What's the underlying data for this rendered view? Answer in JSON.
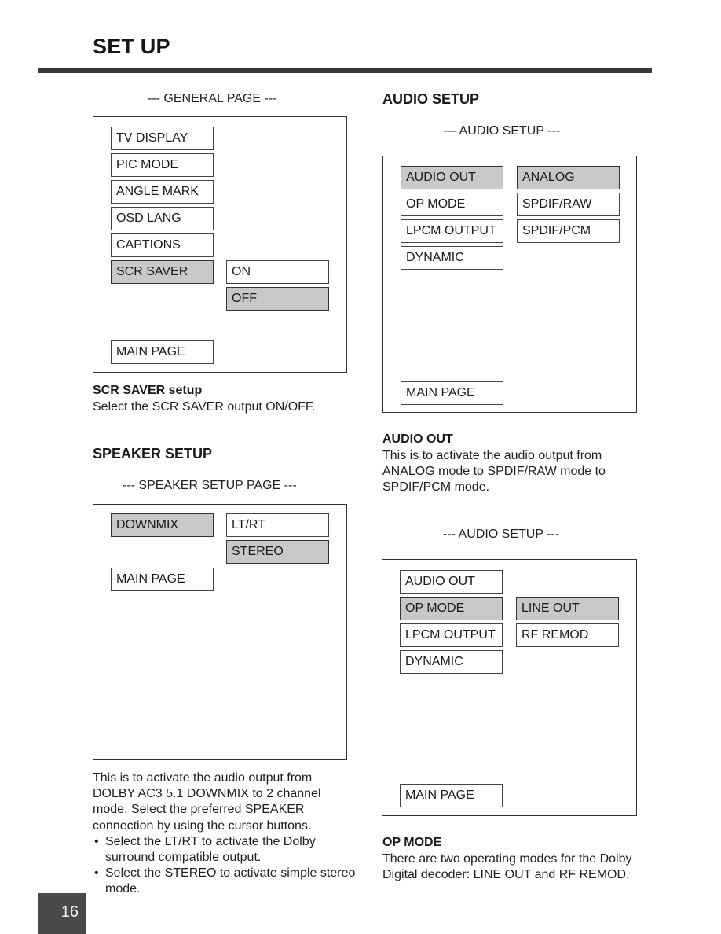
{
  "page": {
    "title": "SET UP",
    "page_number": "16"
  },
  "general": {
    "caption": "--- GENERAL PAGE ---",
    "menu": [
      {
        "label": "TV DISPLAY",
        "selected": false
      },
      {
        "label": "PIC MODE",
        "selected": false
      },
      {
        "label": "ANGLE MARK",
        "selected": false
      },
      {
        "label": "OSD LANG",
        "selected": false
      },
      {
        "label": "CAPTIONS",
        "selected": false
      },
      {
        "label": "SCR SAVER",
        "selected": true
      }
    ],
    "options": [
      {
        "label": "ON",
        "selected": false
      },
      {
        "label": "OFF",
        "selected": true
      }
    ],
    "main_page": "MAIN PAGE",
    "desc_title": "SCR SAVER setup",
    "desc_body": "Select the SCR SAVER output ON/OFF."
  },
  "speaker": {
    "heading": "SPEAKER SETUP",
    "caption": "--- SPEAKER SETUP PAGE ---",
    "menu": [
      {
        "label": "DOWNMIX",
        "selected": true
      }
    ],
    "options": [
      {
        "label": "LT/RT",
        "selected": false
      },
      {
        "label": "STEREO",
        "selected": true
      }
    ],
    "main_page": "MAIN PAGE",
    "desc_body": "This is to activate the audio output from DOLBY AC3 5.1 DOWNMIX to 2 channel mode.  Select the preferred SPEAKER connection by using the cursor buttons.",
    "bullets": [
      "Select the LT/RT to activate the Dolby surround compatible output.",
      "Select the STEREO to activate simple stereo mode."
    ]
  },
  "audio": {
    "heading": "AUDIO SETUP",
    "panel1": {
      "caption": "--- AUDIO SETUP ---",
      "menu": [
        {
          "label": "AUDIO OUT",
          "selected": true
        },
        {
          "label": "OP MODE",
          "selected": false
        },
        {
          "label": "LPCM OUTPUT",
          "selected": false
        },
        {
          "label": "DYNAMIC",
          "selected": false
        }
      ],
      "options": [
        {
          "label": "ANALOG",
          "selected": true
        },
        {
          "label": "SPDIF/RAW",
          "selected": false
        },
        {
          "label": "SPDIF/PCM",
          "selected": false
        }
      ],
      "main_page": "MAIN PAGE",
      "desc_title": "AUDIO OUT",
      "desc_body": "This is to activate the audio output from ANALOG mode to SPDIF/RAW mode to SPDIF/PCM mode."
    },
    "panel2": {
      "caption": "--- AUDIO SETUP ---",
      "menu": [
        {
          "label": "AUDIO OUT",
          "selected": false
        },
        {
          "label": "OP MODE",
          "selected": true
        },
        {
          "label": "LPCM OUTPUT",
          "selected": false
        },
        {
          "label": "DYNAMIC",
          "selected": false
        }
      ],
      "options": [
        {
          "label": "LINE OUT",
          "selected": true
        },
        {
          "label": "RF REMOD",
          "selected": false
        }
      ],
      "main_page": "MAIN PAGE",
      "desc_title": "OP MODE",
      "desc_body": "There are two operating modes for the Dolby Digital decoder:  LINE OUT and RF REMOD."
    }
  }
}
